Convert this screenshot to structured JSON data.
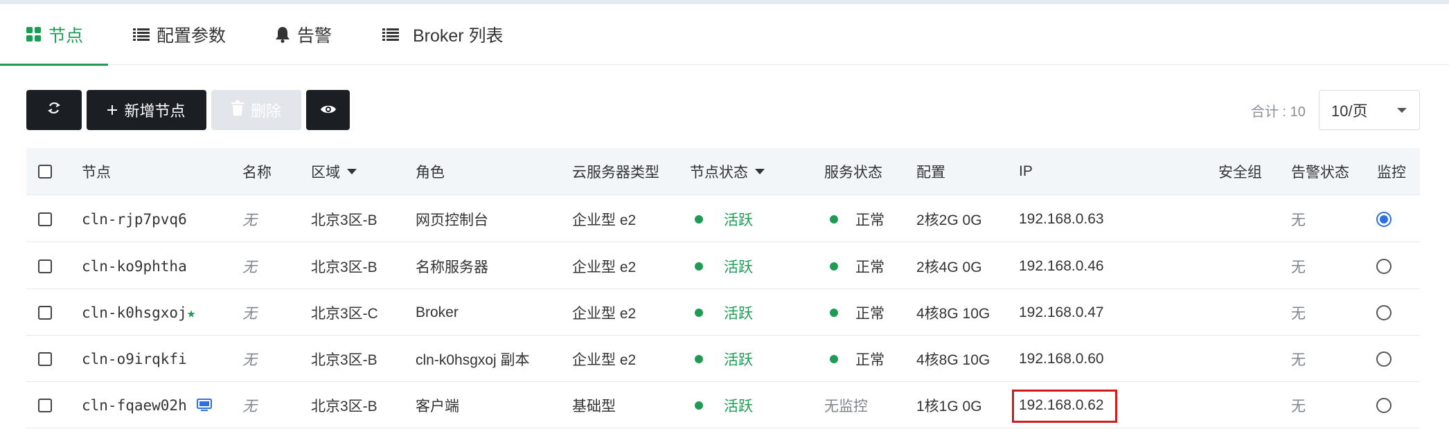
{
  "tabs": [
    {
      "label": "节点",
      "icon": "grid-icon"
    },
    {
      "label": "配置参数",
      "icon": "list-icon"
    },
    {
      "label": "告警",
      "icon": "bell-icon"
    },
    {
      "label": "Broker 列表",
      "icon": "list-icon"
    }
  ],
  "toolbar": {
    "refresh_icon": "refresh-icon",
    "add_label": "新增节点",
    "delete_label": "删除",
    "view_icon": "eye-icon",
    "total": "合计 : 10",
    "page_size": "10/页"
  },
  "table": {
    "columns": [
      "节点",
      "名称",
      "区域",
      "角色",
      "云服务器类型",
      "节点状态",
      "服务状态",
      "配置",
      "IP",
      "安全组",
      "告警状态",
      "监控"
    ],
    "rows": [
      {
        "node": "cln-rjp7pvq6",
        "name": "无",
        "zone": "北京3区-B",
        "role": "网页控制台",
        "type": "企业型 e2",
        "node_status": "活跃",
        "service_status": "正常",
        "config": "2核2G 0G",
        "ip": "192.168.0.63",
        "security_group": "",
        "alert_status": "无",
        "monitor_selected": true
      },
      {
        "node": "cln-ko9phtha",
        "name": "无",
        "zone": "北京3区-B",
        "role": "名称服务器",
        "type": "企业型 e2",
        "node_status": "活跃",
        "service_status": "正常",
        "config": "2核4G 0G",
        "ip": "192.168.0.46",
        "security_group": "",
        "alert_status": "无",
        "monitor_selected": false
      },
      {
        "node": "cln-k0hsgxoj",
        "node_suffix": "★",
        "name": "无",
        "zone": "北京3区-C",
        "role": "Broker",
        "type": "企业型 e2",
        "node_status": "活跃",
        "service_status": "正常",
        "config": "4核8G 10G",
        "ip": "192.168.0.47",
        "security_group": "",
        "alert_status": "无",
        "monitor_selected": false
      },
      {
        "node": "cln-o9irqkfi",
        "name": "无",
        "zone": "北京3区-B",
        "role": "cln-k0hsgxoj 副本",
        "type": "企业型 e2",
        "node_status": "活跃",
        "service_status": "正常",
        "config": "4核8G 10G",
        "ip": "192.168.0.60",
        "security_group": "",
        "alert_status": "无",
        "monitor_selected": false
      },
      {
        "node": "cln-fqaew02h",
        "node_icon": "monitor-icon",
        "name": "无",
        "zone": "北京3区-B",
        "role": "客户端",
        "type": "基础型",
        "node_status": "活跃",
        "service_status": "无监控",
        "config": "1核1G 0G",
        "ip": "192.168.0.62",
        "security_group": "",
        "alert_status": "无",
        "monitor_selected": false
      }
    ]
  },
  "colors": {
    "accent": "#1f9b56",
    "dark_button": "#1b1f23",
    "radio_selected": "#2f6fe0",
    "highlight": "#d11a1a"
  }
}
